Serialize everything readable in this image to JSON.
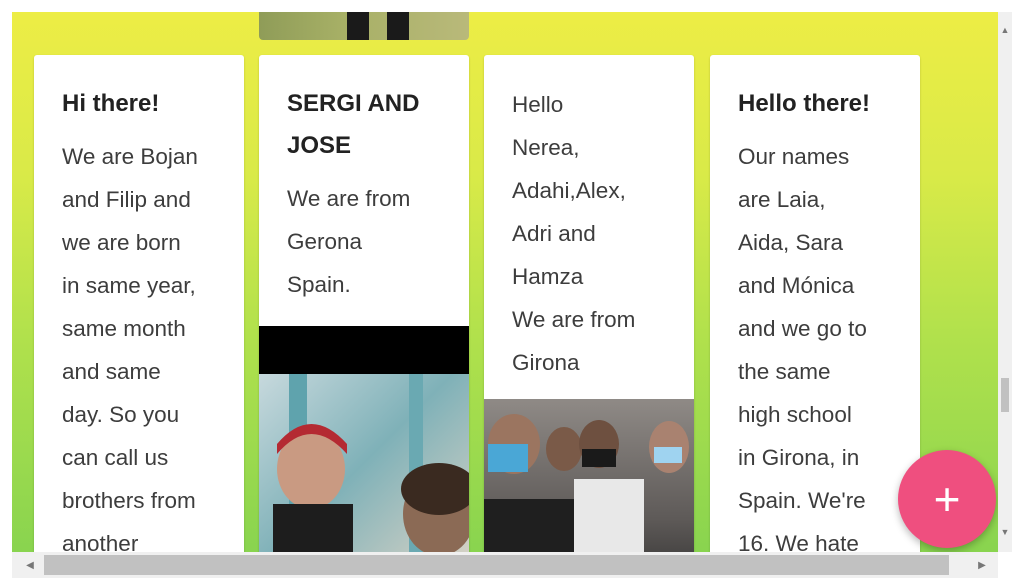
{
  "cards": [
    {
      "title": "Hi there!",
      "body": "We are Bojan\nand Filip and\nwe are born\nin same year,\nsame month\nand same\nday. So you\ncan call us\nbrothers from\nanother"
    },
    {
      "title": "SERGI AND\nJOSE",
      "body": "We are from\nGerona\nSpain."
    },
    {
      "title": "",
      "body": "Hello\nNerea,\nAdahi,Alex,\nAdri and\nHamza\nWe are from\nGirona"
    },
    {
      "title": "Hello there!",
      "body": "Our names\nare Laia,\nAida, Sara\nand Mónica\nand we go to\nthe same\nhigh school\nin Girona, in\nSpain. We're\n16. We hate"
    }
  ],
  "fab": {
    "label": "+",
    "icon": "plus-icon",
    "color": "#ef4f7f"
  },
  "colors": {
    "background_top": "#eded45",
    "background_bottom": "#89d44f",
    "card": "#ffffff"
  }
}
